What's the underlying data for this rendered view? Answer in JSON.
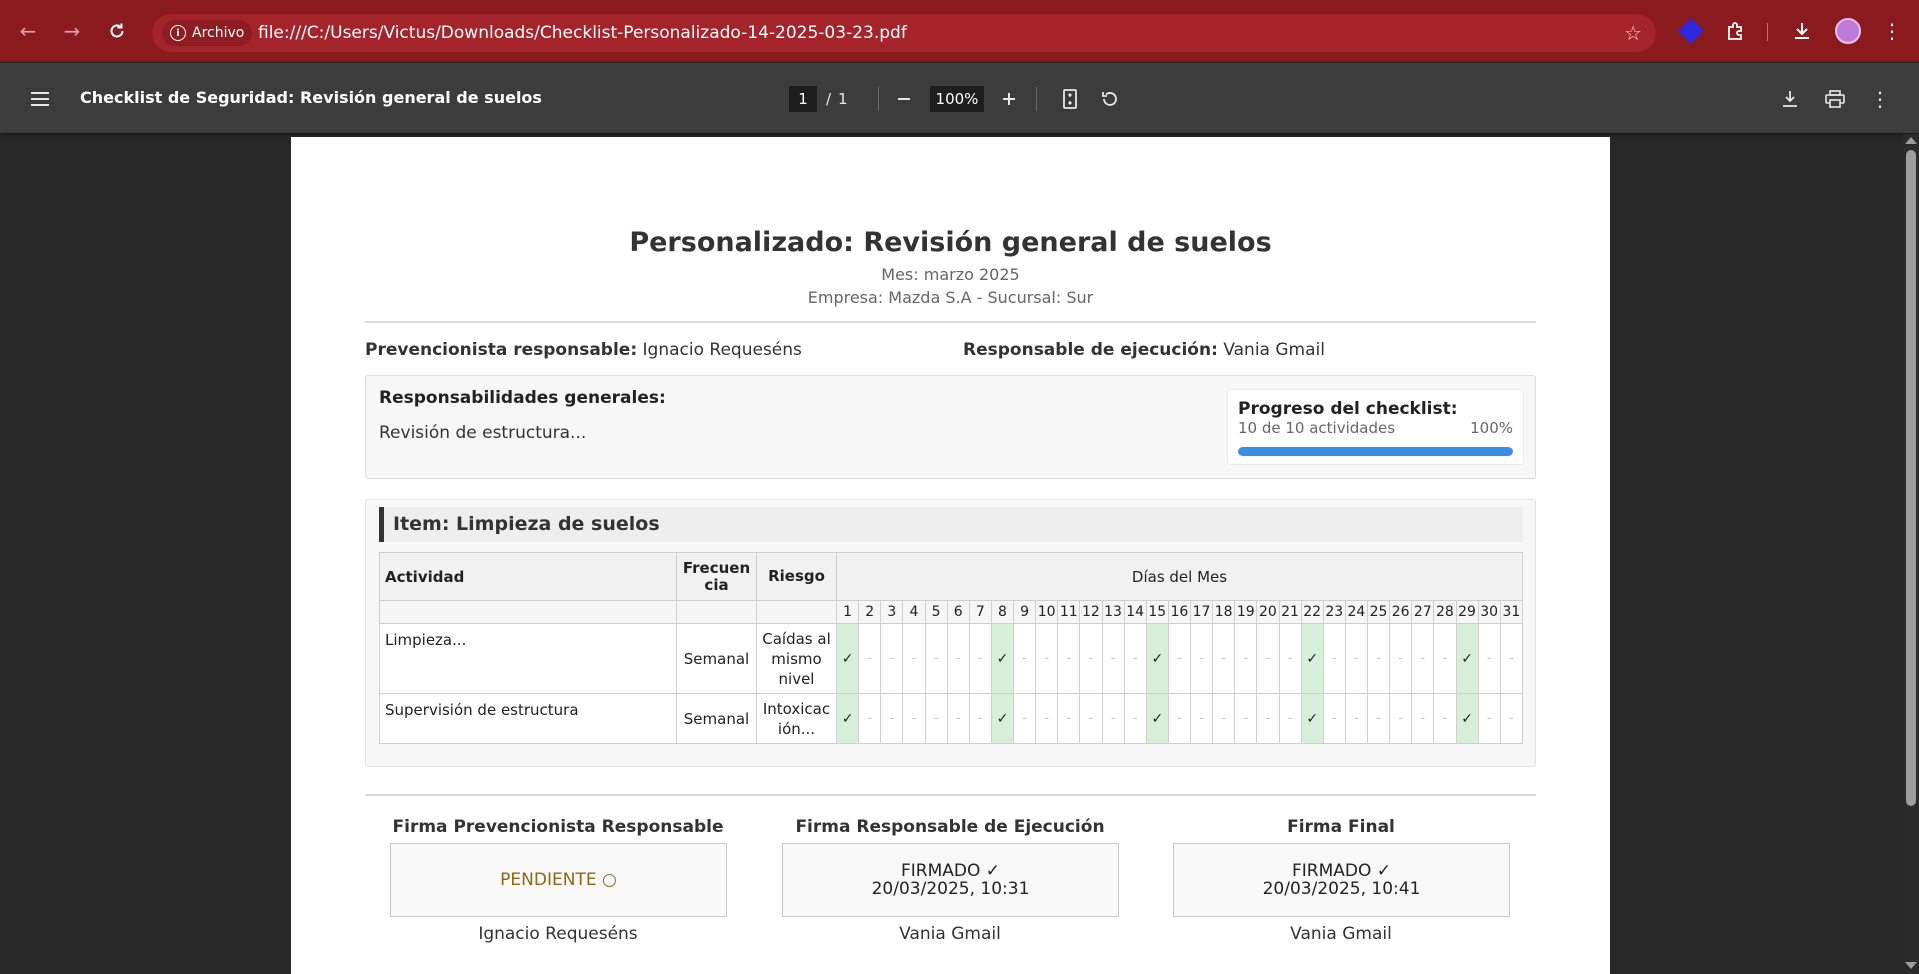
{
  "browser": {
    "chip_label": "Archivo",
    "url": "file:///C:/Users/Victus/Downloads/Checklist-Personalizado-14-2025-03-23.pdf"
  },
  "pdf_toolbar": {
    "title": "Checklist de Seguridad: Revisión general de suelos",
    "page_current": "1",
    "page_separator": "/",
    "page_total": "1",
    "zoom": "100%"
  },
  "document": {
    "title": "Personalizado: Revisión general de suelos",
    "month_line": "Mes: marzo 2025",
    "company_line": "Empresa: Mazda S.A - Sucursal: Sur",
    "preventionist_label": "Prevencionista responsable:",
    "preventionist_value": "Ignacio Requeséns",
    "executor_label": "Responsable de ejecución:",
    "executor_value": "Vania Gmail",
    "responsibilities_title": "Responsabilidades generales:",
    "responsibilities_text": "Revisión de estructura...",
    "progress": {
      "title": "Progreso del checklist:",
      "count_text": "10 de 10 actividades",
      "percent_text": "100%",
      "fraction": 1.0
    },
    "item": {
      "header": "Item: Limpieza de suelos",
      "columns": {
        "activity": "Actividad",
        "frequency": "Frecuen cia",
        "risk": "Riesgo",
        "days": "Días del Mes"
      },
      "days": [
        "1",
        "2",
        "3",
        "4",
        "5",
        "6",
        "7",
        "8",
        "9",
        "10",
        "11",
        "12",
        "13",
        "14",
        "15",
        "16",
        "17",
        "18",
        "19",
        "20",
        "21",
        "22",
        "23",
        "24",
        "25",
        "26",
        "27",
        "28",
        "29",
        "30",
        "31"
      ],
      "check_mark": "✓",
      "empty_mark": "-",
      "rows": [
        {
          "activity": "Limpieza...",
          "frequency": "Semanal",
          "risk": "Caídas al mismo nivel",
          "checked_days": [
            1,
            8,
            15,
            22,
            29
          ]
        },
        {
          "activity": "Supervisión de estructura",
          "frequency": "Semanal",
          "risk": "Intoxicac ión...",
          "checked_days": [
            1,
            8,
            15,
            22,
            29
          ]
        }
      ]
    },
    "signatures": [
      {
        "title": "Firma Prevencionista Responsable",
        "status_line1": "PENDIENTE ○",
        "status_line2": "",
        "name": "Ignacio Requeséns",
        "pending": true
      },
      {
        "title": "Firma Responsable de Ejecución",
        "status_line1": "FIRMADO ✓",
        "status_line2": "20/03/2025, 10:31",
        "name": "Vania Gmail",
        "pending": false
      },
      {
        "title": "Firma Final",
        "status_line1": "FIRMADO ✓",
        "status_line2": "20/03/2025, 10:41",
        "name": "Vania Gmail",
        "pending": false
      }
    ]
  },
  "colors": {
    "browser_frame": "#8b1a1f",
    "progress_fill": "#3a8ee6",
    "checked_cell": "#d5efd9",
    "pending_text": "#8b6914"
  }
}
